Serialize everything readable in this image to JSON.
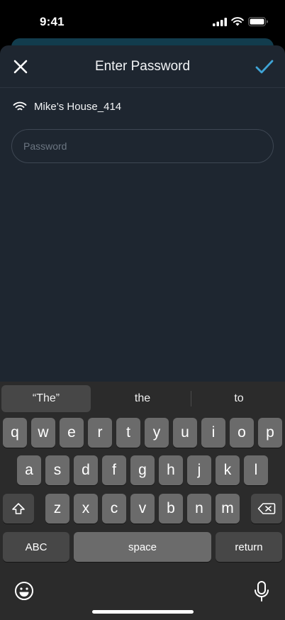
{
  "status_bar": {
    "time": "9:41"
  },
  "header": {
    "title": "Enter Password",
    "close_icon": "close-icon",
    "confirm_icon": "checkmark-icon"
  },
  "network": {
    "icon": "wifi-icon",
    "name": "Mike’s House_414"
  },
  "password_field": {
    "placeholder": "Password",
    "value": ""
  },
  "keyboard": {
    "suggestions": [
      "“The”",
      "the",
      "to"
    ],
    "row1": [
      "q",
      "w",
      "e",
      "r",
      "t",
      "y",
      "u",
      "i",
      "o",
      "p"
    ],
    "row2": [
      "a",
      "s",
      "d",
      "f",
      "g",
      "h",
      "j",
      "k",
      "l"
    ],
    "row3": [
      "z",
      "x",
      "c",
      "v",
      "b",
      "n",
      "m"
    ],
    "abc_label": "ABC",
    "space_label": "space",
    "return_label": "return"
  },
  "colors": {
    "accent": "#3fa4d6",
    "sheet_background": "#1e2630",
    "keyboard_background": "#2b2b2b",
    "key": "#6b6b6b"
  }
}
